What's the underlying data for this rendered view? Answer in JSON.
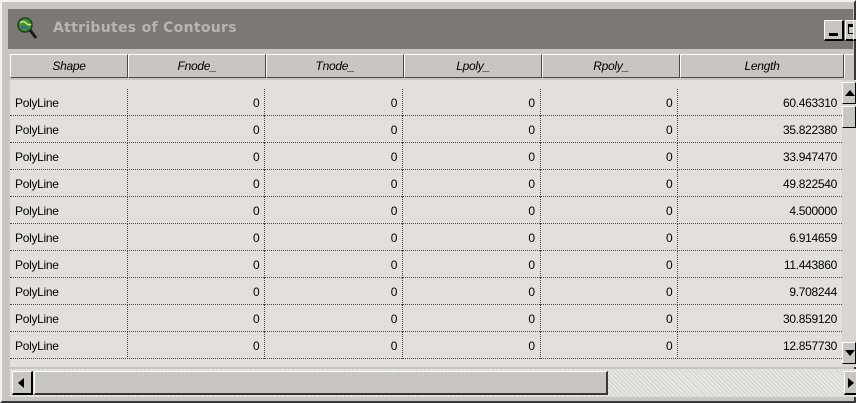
{
  "window": {
    "title": "Attributes of Contours",
    "icon": "magnifier-globe-icon"
  },
  "columns": [
    "Shape",
    "Fnode_",
    "Tnode_",
    "Lpoly_",
    "Rpoly_",
    "Length"
  ],
  "rows": [
    [
      "PolyLine",
      "0",
      "0",
      "0",
      "0",
      "60.463310"
    ],
    [
      "PolyLine",
      "0",
      "0",
      "0",
      "0",
      "35.822380"
    ],
    [
      "PolyLine",
      "0",
      "0",
      "0",
      "0",
      "33.947470"
    ],
    [
      "PolyLine",
      "0",
      "0",
      "0",
      "0",
      "49.822540"
    ],
    [
      "PolyLine",
      "0",
      "0",
      "0",
      "0",
      "4.500000"
    ],
    [
      "PolyLine",
      "0",
      "0",
      "0",
      "0",
      "6.914659"
    ],
    [
      "PolyLine",
      "0",
      "0",
      "0",
      "0",
      "11.443860"
    ],
    [
      "PolyLine",
      "0",
      "0",
      "0",
      "0",
      "9.708244"
    ],
    [
      "PolyLine",
      "0",
      "0",
      "0",
      "0",
      "30.859120"
    ],
    [
      "PolyLine",
      "0",
      "0",
      "0",
      "0",
      "12.857730"
    ]
  ],
  "colors": {
    "titlebar": "#7d7874",
    "window_face": "#c9c5c1",
    "grid_background": "#e3e0dc"
  }
}
